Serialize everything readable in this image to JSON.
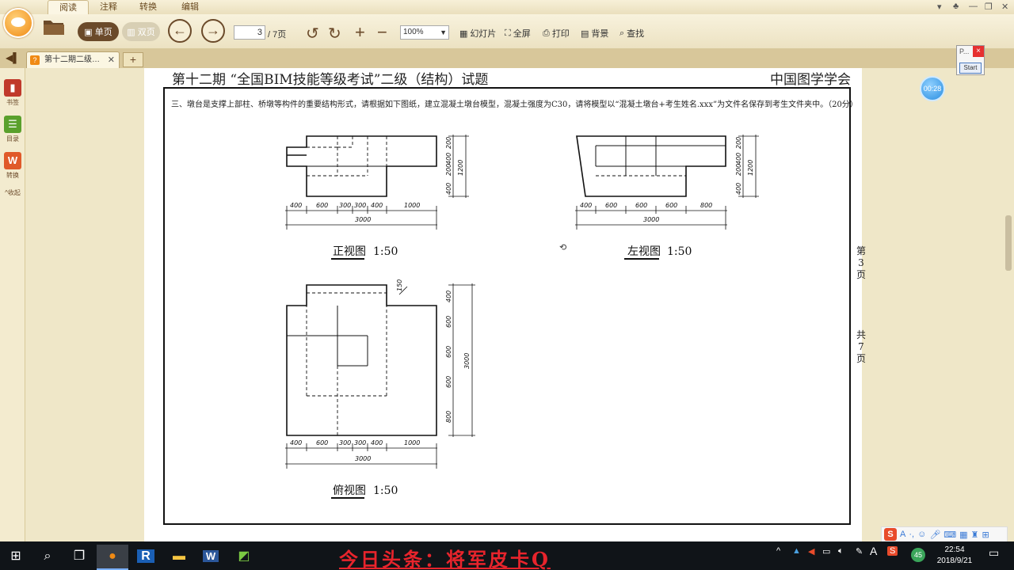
{
  "menu": {
    "tabs": [
      "阅读",
      "注释",
      "转换",
      "编辑"
    ]
  },
  "toolbar": {
    "single_page": "单页",
    "double_page": "双页",
    "page_current": "3",
    "page_total": "/ 7页",
    "zoom": "100%",
    "slideshow": "幻灯片",
    "fullscreen": "全屏",
    "print": "打印",
    "background": "背景",
    "search": "查找"
  },
  "tab": {
    "title": "第十二期二级…"
  },
  "sidebar": {
    "items": [
      "书签",
      "目录",
      "转换",
      "收起"
    ]
  },
  "document": {
    "title": "第十二期 “全国BIM技能等级考试”二级（结构）试题",
    "org": "中国图学学会",
    "question": "三、墩台是支撑上部柱、桥墩等构件的重要结构形式，请根据如下图纸，建立混凝土墩台模型，混凝土强度为C30，请将模型以“混凝土墩台+考生姓名.xxx”为文件名保存到考生文件夹中。（20分）",
    "page_label": [
      "第",
      "3",
      "页"
    ],
    "total_label": [
      "共",
      "7",
      "页"
    ],
    "views": {
      "front": {
        "label": "正视图",
        "scale": "1:50"
      },
      "left": {
        "label": "左视图",
        "scale": "1:50"
      },
      "top": {
        "label": "俯视图",
        "scale": "1:50"
      }
    },
    "dims": {
      "front_h": [
        "400",
        "600",
        "300",
        "300",
        "400",
        "1000"
      ],
      "front_total": "3000",
      "front_v": [
        "200",
        "400",
        "200",
        "400"
      ],
      "front_v_total": "1200",
      "left_h": [
        "400",
        "600",
        "600",
        "600",
        "800"
      ],
      "left_total": "3000",
      "left_v": [
        "200",
        "400",
        "200",
        "400"
      ],
      "left_v_total": "1200",
      "top_h": [
        "400",
        "600",
        "300",
        "300",
        "400",
        "1000"
      ],
      "top_total": "3000",
      "top_v": [
        "400",
        "600",
        "600",
        "600",
        "800"
      ],
      "top_v_total": "3000",
      "top_notch": "150"
    }
  },
  "timer": "00:28",
  "popup": {
    "title": "P...",
    "close": "×",
    "start": "Start"
  },
  "watermark": "今日头条：将军皮卡Q",
  "clock": {
    "time": "22:54",
    "date": "2018/9/21"
  },
  "tray": {
    "lang": "A",
    "battery": "45"
  }
}
